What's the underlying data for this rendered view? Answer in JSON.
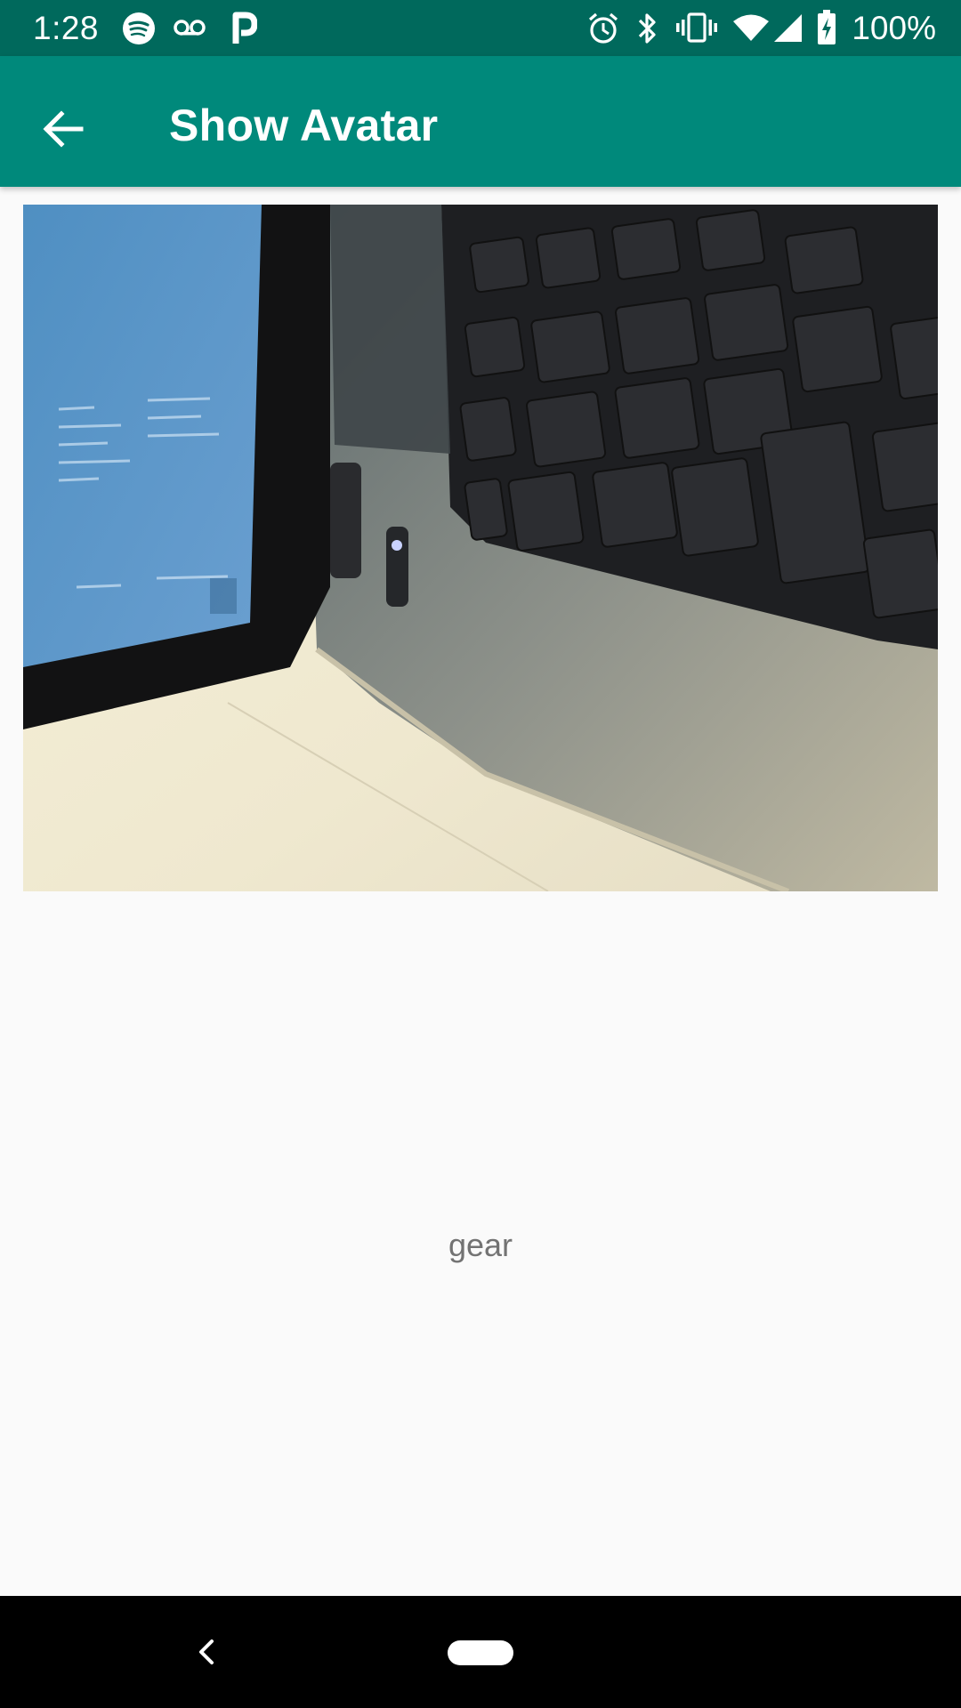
{
  "status_bar": {
    "time": "1:28",
    "battery_percent": "100%",
    "left_icons": [
      "spotify-icon",
      "voicemail-icon",
      "p-app-icon"
    ],
    "right_icons": [
      "alarm-icon",
      "bluetooth-icon",
      "vibrate-icon",
      "wifi-icon",
      "signal-icon",
      "battery-charging-icon"
    ]
  },
  "app_bar": {
    "title": "Show Avatar",
    "back_icon": "arrow-back-icon",
    "color": "#00897b"
  },
  "avatar": {
    "caption": "gear"
  },
  "nav_bar": {
    "back_icon": "nav-back-icon",
    "home_icon": "home-pill-icon"
  },
  "colors": {
    "status_bar": "#00695c",
    "app_bar": "#00897b",
    "background": "#fafafa",
    "caption_text": "#737373"
  }
}
